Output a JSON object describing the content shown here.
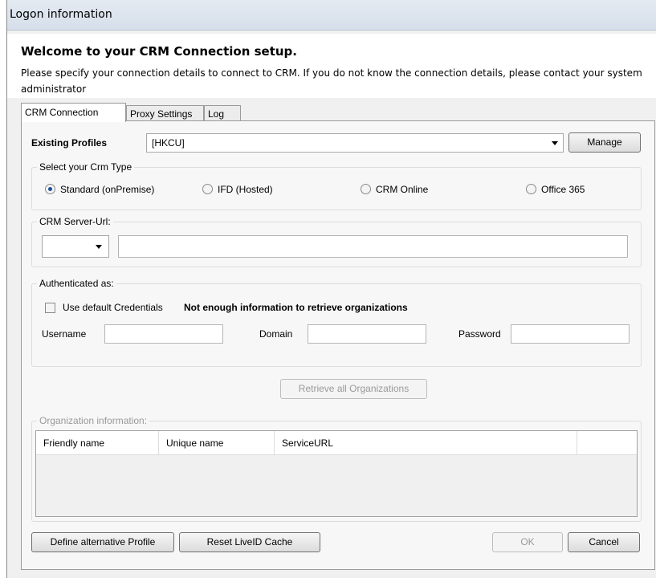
{
  "window": {
    "title": "Logon information"
  },
  "header": {
    "welcome": "Welcome to your CRM Connection setup.",
    "description": "Please specify your connection details to connect to CRM. If you do not know the connection details, please contact your system administrator"
  },
  "tabs": [
    {
      "label": "CRM Connection",
      "active": true
    },
    {
      "label": "Proxy Settings",
      "active": false
    },
    {
      "label": "Log",
      "active": false
    }
  ],
  "profiles": {
    "label": "Existing Profiles",
    "selected": "[HKCU]",
    "manage_label": "Manage"
  },
  "crm_type": {
    "label": "Select your Crm Type",
    "options": [
      {
        "label": "Standard (onPremise)",
        "selected": true
      },
      {
        "label": "IFD (Hosted)",
        "selected": false
      },
      {
        "label": "CRM Online",
        "selected": false
      },
      {
        "label": "Office 365",
        "selected": false
      }
    ]
  },
  "server_url": {
    "label": "CRM Server-Url:",
    "protocol": "",
    "url": ""
  },
  "auth": {
    "label": "Authenticated as:",
    "default_credentials_label": "Use default Credentials",
    "default_credentials_checked": false,
    "status_message": "Not enough information to retrieve organizations",
    "username_label": "Username",
    "username": "",
    "domain_label": "Domain",
    "domain": "",
    "password_label": "Password",
    "password": ""
  },
  "retrieve_button": "Retrieve all Organizations",
  "organization": {
    "label": "Organization information:",
    "columns": [
      "Friendly name",
      "Unique name",
      "ServiceURL",
      ""
    ]
  },
  "footer": {
    "define_profile": "Define alternative Profile",
    "reset_cache": "Reset LiveID Cache",
    "ok": "OK",
    "cancel": "Cancel"
  },
  "colors": {
    "radio_selected": "#1f4f9a",
    "disabled_text": "#9a9a9a"
  }
}
